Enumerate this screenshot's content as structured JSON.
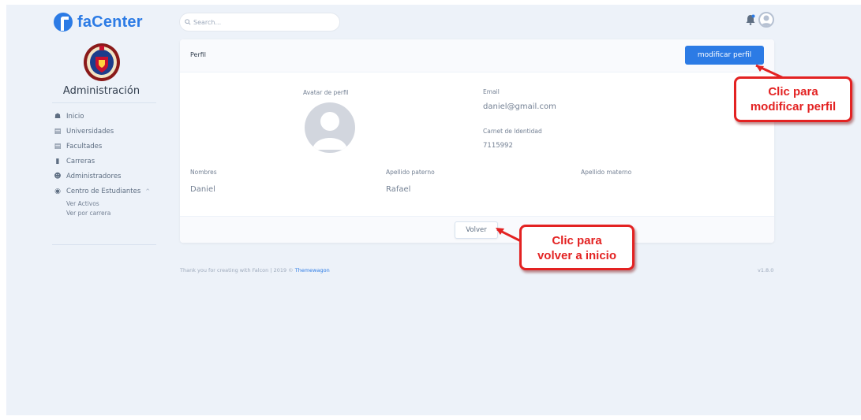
{
  "app": {
    "logo_text": "faCenter"
  },
  "search": {
    "placeholder": "Search..."
  },
  "sidebar": {
    "title": "Administración",
    "items": [
      {
        "label": "Inicio",
        "icon": "home-icon"
      },
      {
        "label": "Universidades",
        "icon": "university-icon"
      },
      {
        "label": "Facultades",
        "icon": "university-icon"
      },
      {
        "label": "Carreras",
        "icon": "book-icon"
      },
      {
        "label": "Administradores",
        "icon": "users-icon"
      },
      {
        "label": "Centro de Estudiantes",
        "icon": "globe-icon",
        "caret": "^"
      }
    ],
    "subitems": [
      {
        "label": "Ver Activos"
      },
      {
        "label": "Ver por carrera"
      }
    ]
  },
  "card": {
    "title": "Perfil",
    "edit_button": "modificar perfil",
    "avatar_label": "Avatar de perfil",
    "email_label": "Email",
    "email_value": "daniel@gmail.com",
    "ci_label": "Carnet de Identidad",
    "ci_value": "7115992",
    "nombres_label": "Nombres",
    "nombres_value": "Daniel",
    "ap_paterno_label": "Apellido paterno",
    "ap_paterno_value": "Rafael",
    "ap_materno_label": "Apellido materno",
    "ap_materno_value": "",
    "back_button": "Volver"
  },
  "footer": {
    "text": "Thank you for creating with Falcon | 2019 © ",
    "link": "Themewagon",
    "version": "v1.8.0"
  },
  "callouts": {
    "edit_line1": "Clic para",
    "edit_line2": "modificar perfil",
    "back_line1": "Clic para",
    "back_line2": "volver a inicio"
  },
  "colors": {
    "primary": "#2c7be5",
    "background": "#edf2f9",
    "callout_red": "#e32222"
  }
}
